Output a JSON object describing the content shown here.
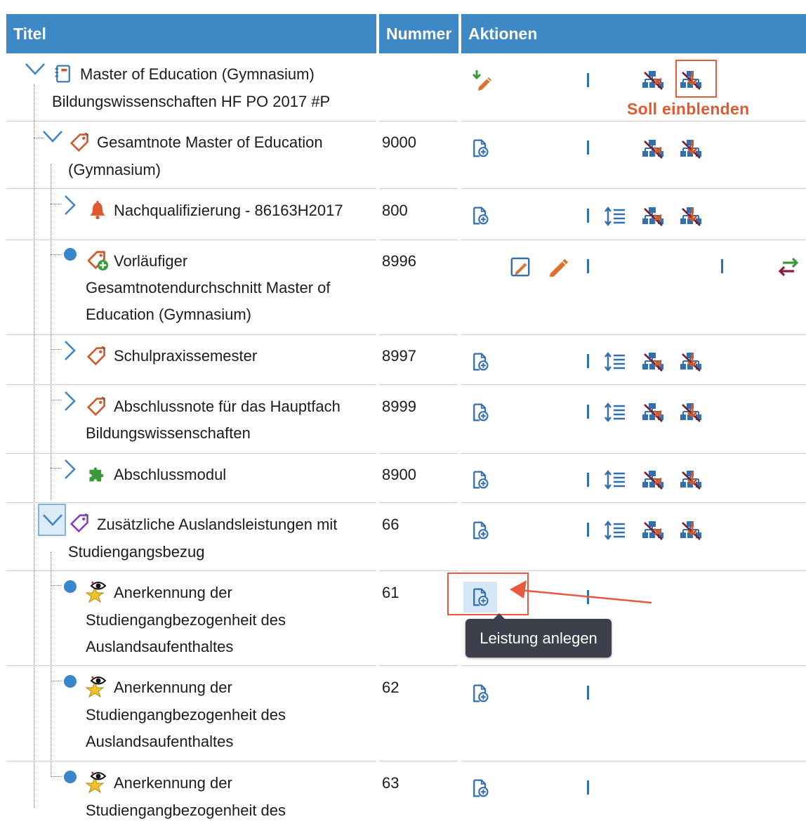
{
  "columns": {
    "titel": "Titel",
    "nummer": "Nummer",
    "aktionen": "Aktionen"
  },
  "rows": [
    {
      "title_lines": [
        "Master of Education (Gymnasium)",
        "Bildungswissenschaften HF PO 2017 #P"
      ],
      "number": ""
    },
    {
      "title_lines": [
        "Gesamtnote Master of Education",
        "(Gymnasium)"
      ],
      "number": "9000"
    },
    {
      "title_lines": [
        "Nachqualifizierung - 86163H2017"
      ],
      "number": "800"
    },
    {
      "title_lines": [
        "Vorläufiger",
        "Gesamtnotendurchschnitt Master of",
        "Education (Gymnasium)"
      ],
      "number": "8996"
    },
    {
      "title_lines": [
        "Schulpraxissemester"
      ],
      "number": "8997"
    },
    {
      "title_lines": [
        "Abschlussnote für das Hauptfach",
        "Bildungswissenschaften"
      ],
      "number": "8999"
    },
    {
      "title_lines": [
        "Abschlussmodul"
      ],
      "number": "8900"
    },
    {
      "title_lines": [
        "Zusätzliche Auslandsleistungen mit",
        "Studiengangsbezug"
      ],
      "number": "66"
    },
    {
      "title_lines": [
        "Anerkennung der",
        "Studiengangbezogenheit des",
        "Auslandsaufenthaltes"
      ],
      "number": "61"
    },
    {
      "title_lines": [
        "Anerkennung der",
        "Studiengangbezogenheit des",
        "Auslandsaufenthaltes"
      ],
      "number": "62"
    },
    {
      "title_lines": [
        "Anerkennung der",
        "Studiengangbezogenheit des"
      ],
      "number": "63"
    }
  ],
  "annotations": {
    "soll_einblenden": "Soll einblenden"
  },
  "tooltip": {
    "text": "Leistung anlegen"
  },
  "colors": {
    "header": "#3f88c6",
    "accent_blue": "#2f6fb3",
    "annotation_red": "#e85a3b",
    "tooltip_bg": "#3e3f4c"
  }
}
